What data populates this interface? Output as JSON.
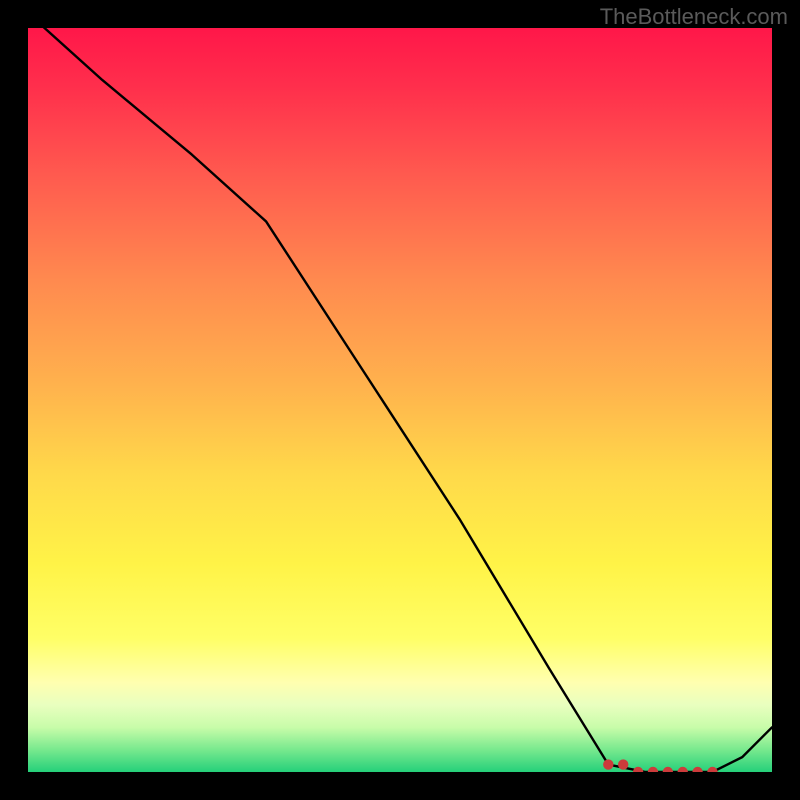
{
  "attribution": "TheBottleneck.com",
  "chart_data": {
    "type": "line",
    "title": "",
    "xlabel": "",
    "ylabel": "",
    "xlim": [
      0,
      100
    ],
    "ylim": [
      0,
      100
    ],
    "grid": false,
    "series": [
      {
        "name": "curve",
        "x": [
          0,
          10,
          22,
          32,
          45,
          58,
          70,
          78,
          83,
          87,
          92,
          96,
          100
        ],
        "values": [
          102,
          93,
          83,
          74,
          54,
          34,
          14,
          1,
          0,
          0,
          0,
          2,
          6
        ]
      }
    ],
    "markers": {
      "name": "highlighted-range",
      "x": [
        78,
        80,
        82,
        84,
        86,
        88,
        90,
        92
      ],
      "values": [
        1,
        1,
        0,
        0,
        0,
        0,
        0,
        0
      ]
    },
    "gradient_stops": [
      {
        "pos": 0.0,
        "color": "#ff1749"
      },
      {
        "pos": 0.08,
        "color": "#ff2f4c"
      },
      {
        "pos": 0.2,
        "color": "#ff5b4f"
      },
      {
        "pos": 0.34,
        "color": "#ff8a4f"
      },
      {
        "pos": 0.48,
        "color": "#ffb24d"
      },
      {
        "pos": 0.6,
        "color": "#ffd94a"
      },
      {
        "pos": 0.72,
        "color": "#fff347"
      },
      {
        "pos": 0.82,
        "color": "#ffff66"
      },
      {
        "pos": 0.88,
        "color": "#ffffb0"
      },
      {
        "pos": 0.91,
        "color": "#e9ffbf"
      },
      {
        "pos": 0.94,
        "color": "#c8fca9"
      },
      {
        "pos": 0.97,
        "color": "#78e98e"
      },
      {
        "pos": 1.0,
        "color": "#25d07a"
      }
    ]
  }
}
